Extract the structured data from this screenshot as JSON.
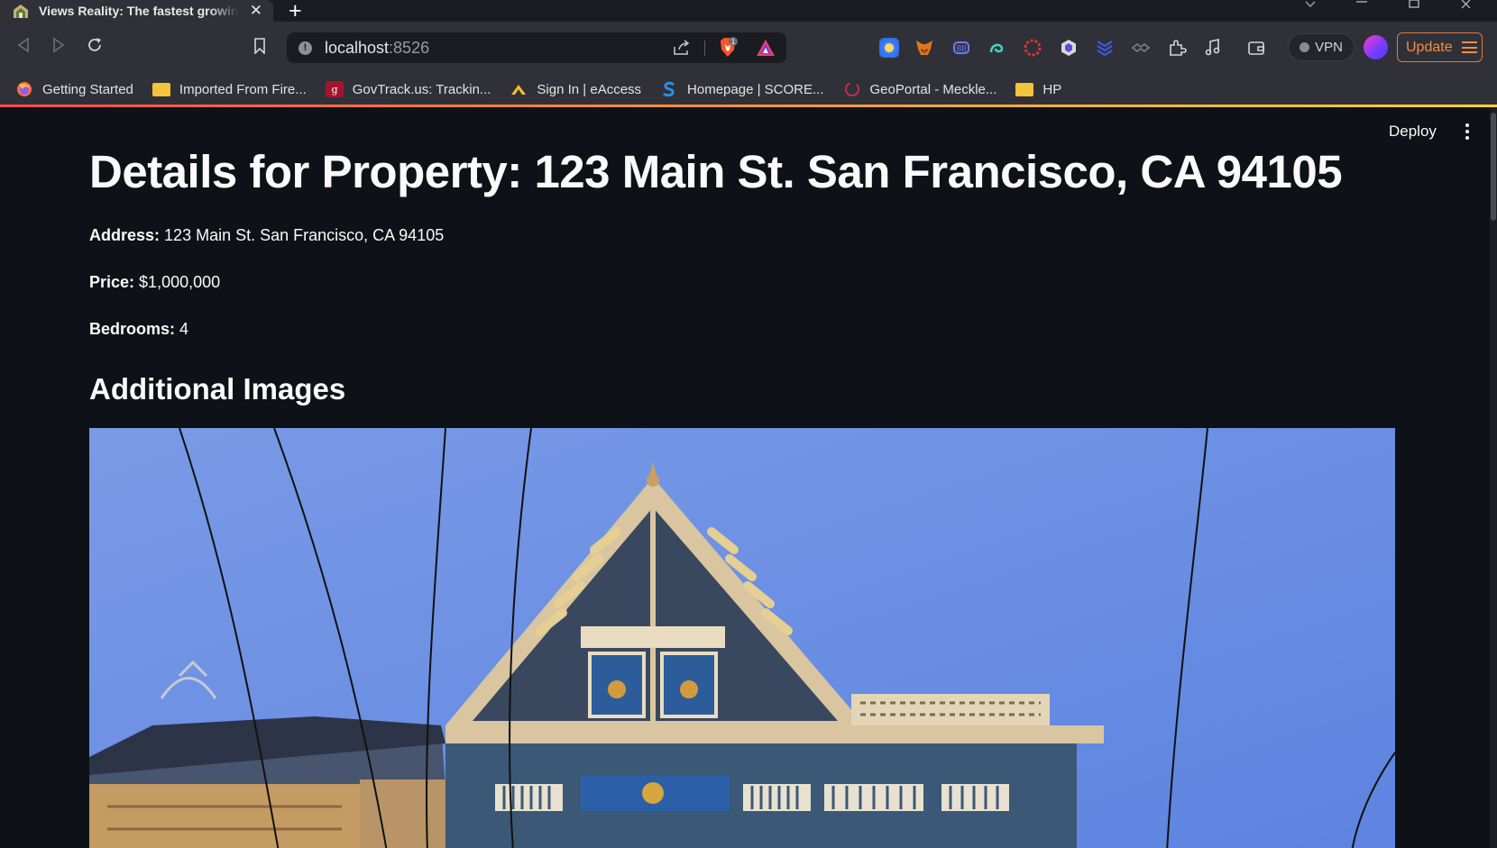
{
  "browser": {
    "tab_title": "Views Reality: The fastest growing",
    "tab_close": "✕",
    "new_tab": "+",
    "url_host": "localhost",
    "url_port": ":8526",
    "shield_badge": "1",
    "vpn_label": "VPN",
    "update_label": "Update",
    "bookmarks": [
      {
        "label": "Getting Started",
        "icon": "firefox-icon"
      },
      {
        "label": "Imported From Fire...",
        "icon": "folder-icon"
      },
      {
        "label": "GovTrack.us: Trackin...",
        "icon": "govtrack-icon"
      },
      {
        "label": "Sign In | eAccess",
        "icon": "eaccess-icon"
      },
      {
        "label": "Homepage | SCORE...",
        "icon": "score-icon"
      },
      {
        "label": "GeoPortal - Meckle...",
        "icon": "geoportal-icon"
      },
      {
        "label": "HP",
        "icon": "folder-icon"
      }
    ]
  },
  "app": {
    "deploy_label": "Deploy",
    "title": "Details for Property: 123 Main St. San Francisco, CA 94105",
    "address_label": "Address:",
    "address_value": "123 Main St. San Francisco, CA 94105",
    "price_label": "Price:",
    "price_value": "$1,000,000",
    "bedrooms_label": "Bedrooms:",
    "bedrooms_value": "4",
    "images_heading": "Additional Images"
  },
  "colors": {
    "app_bg": "#0e1117",
    "chrome_bg": "#303138",
    "accent_gradient": [
      "#ff4b4b",
      "#ffd23b"
    ],
    "update_accent": "#f28c4c",
    "sky": "#6f93e6"
  }
}
